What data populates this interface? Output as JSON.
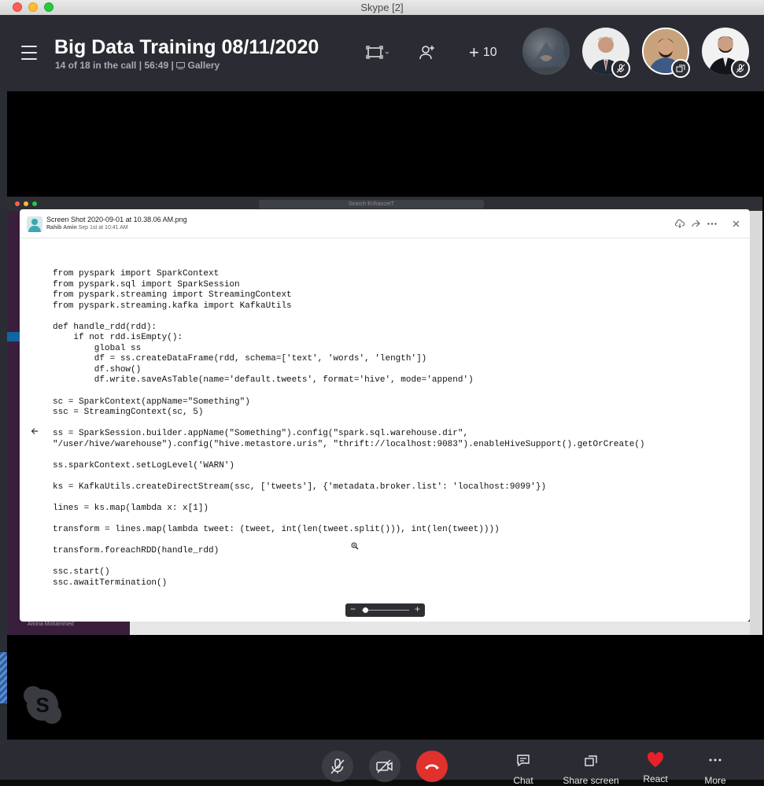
{
  "window": {
    "title": "Skype [2]"
  },
  "call": {
    "title": "Big Data Training 08/11/2020",
    "participants": "14 of 18 in the call",
    "separator": "|",
    "duration": "56:49",
    "view": "Gallery",
    "more_participants": "10"
  },
  "viewer": {
    "filename": "Screen Shot 2020-09-01 at 10.38.06 AM.png",
    "author": "Rahib Amin",
    "date": "Sep 1st at 10:41 AM",
    "code": "from pyspark import SparkContext\nfrom pyspark.sql import SparkSession\nfrom pyspark.streaming import StreamingContext\nfrom pyspark.streaming.kafka import KafkaUtils\n\ndef handle_rdd(rdd):\n    if not rdd.isEmpty():\n        global ss\n        df = ss.createDataFrame(rdd, schema=['text', 'words', 'length'])\n        df.show()\n        df.write.saveAsTable(name='default.tweets', format='hive', mode='append')\n\nsc = SparkContext(appName=\"Something\")\nssc = StreamingContext(sc, 5)\n\nss = SparkSession.builder.appName(\"Something\").config(\"spark.sql.warehouse.dir\",\n\"/user/hive/warehouse\").config(\"hive.metastore.uris\", \"thrift://localhost:9083\").enableHiveSupport().getOrCreate()\n\nss.sparkContext.setLogLevel('WARN')\n\nks = KafkaUtils.createDirectStream(ssc, ['tweets'], {'metadata.broker.list': 'localhost:9099'})\n\nlines = ks.map(lambda x: x[1])\n\ntransform = lines.map(lambda tweet: (tweet, int(len(tweet.split())), int(len(tweet))))\n\ntransform.foreachRDD(handle_rdd)\n\nssc.start()\nssc.awaitTermination()",
    "zoom_minus": "−",
    "zoom_plus": "+",
    "zoom_level": 0.03
  },
  "shared_screen": {
    "search_placeholder": "Search EnhanceIT",
    "sidebar_footer": "Amina Mohammed"
  },
  "controls": {
    "chat": "Chat",
    "share": "Share screen",
    "react": "React",
    "more": "More"
  },
  "colors": {
    "header_bg": "#2b2c33",
    "end_call": "#e0312d",
    "react_heart": "#e8202a"
  }
}
